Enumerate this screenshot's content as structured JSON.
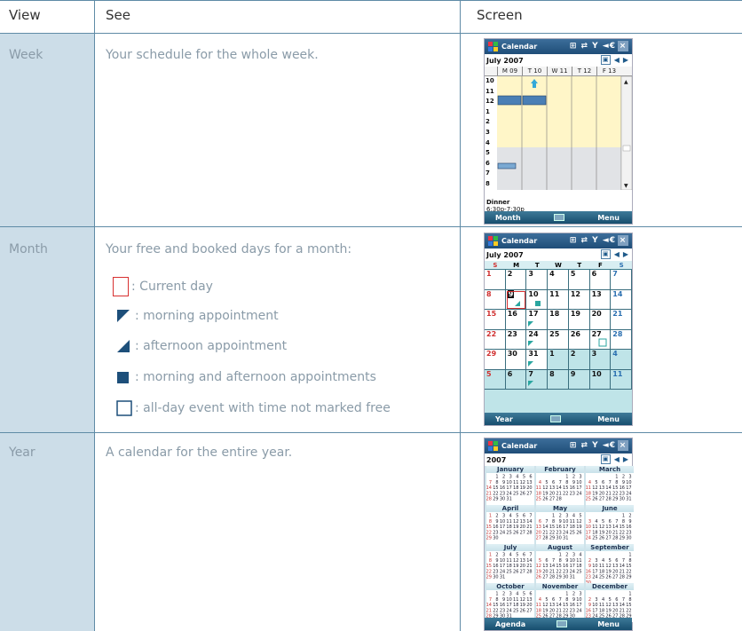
{
  "table": {
    "headers": {
      "view": "View",
      "see": "See",
      "screen": "Screen"
    },
    "rows": [
      {
        "view": "Week",
        "see": "Your schedule for the whole week."
      },
      {
        "view": "Month",
        "see": "Your free and booked days for a month:"
      },
      {
        "view": "Year",
        "see": "A calendar for the entire year."
      }
    ],
    "legend": [
      {
        "icon": "current-day-box",
        "text": ": Current day"
      },
      {
        "icon": "morning-triangle",
        "text": ": morning appointment"
      },
      {
        "icon": "afternoon-triangle",
        "text": ": afternoon appointment"
      },
      {
        "icon": "filled-square",
        "text": ": morning and afternoon appointments"
      },
      {
        "icon": "outline-square",
        "text": ": all-day event with time not marked free"
      }
    ]
  },
  "colors": {
    "view_column": "#ccdde8",
    "grid_line": "#5f8ba6",
    "label_text": "#8a9ba8",
    "accent_red": "#d83030",
    "marker_teal": "#2aa6a0",
    "title_bar": "#1f4d78"
  },
  "screens": {
    "title": "Calendar",
    "status_icons": "⊞ ⇄ Y ◄€",
    "close": "×",
    "week": {
      "period": "July 2007",
      "days": [
        "M 09",
        "T 10",
        "W 11",
        "T 12",
        "F 13"
      ],
      "hours": [
        "10",
        "11",
        "12",
        "1",
        "2",
        "3",
        "4",
        "5",
        "6",
        "7",
        "8"
      ],
      "appt_title": "Dinner",
      "appt_time": "6:30p-7:30p",
      "left_soft": "Month",
      "right_soft": "Menu"
    },
    "month": {
      "period": "July 2007",
      "weekdays": [
        "S",
        "M",
        "T",
        "W",
        "T",
        "F",
        "S"
      ],
      "dates": [
        "1",
        "2",
        "3",
        "4",
        "5",
        "6",
        "7",
        "8",
        "9",
        "10",
        "11",
        "12",
        "13",
        "14",
        "15",
        "16",
        "17",
        "18",
        "19",
        "20",
        "21",
        "22",
        "23",
        "24",
        "25",
        "26",
        "27",
        "28",
        "29",
        "30",
        "31",
        "1",
        "2",
        "3",
        "4",
        "5",
        "6",
        "7",
        "8",
        "9",
        "10",
        "11"
      ],
      "left_soft": "Year",
      "right_soft": "Menu"
    },
    "year": {
      "period": "2007",
      "months": [
        "January",
        "February",
        "March",
        "April",
        "May",
        "June",
        "July",
        "August",
        "September",
        "October",
        "November",
        "December"
      ],
      "left_soft": "Agenda",
      "right_soft": "Menu"
    }
  }
}
